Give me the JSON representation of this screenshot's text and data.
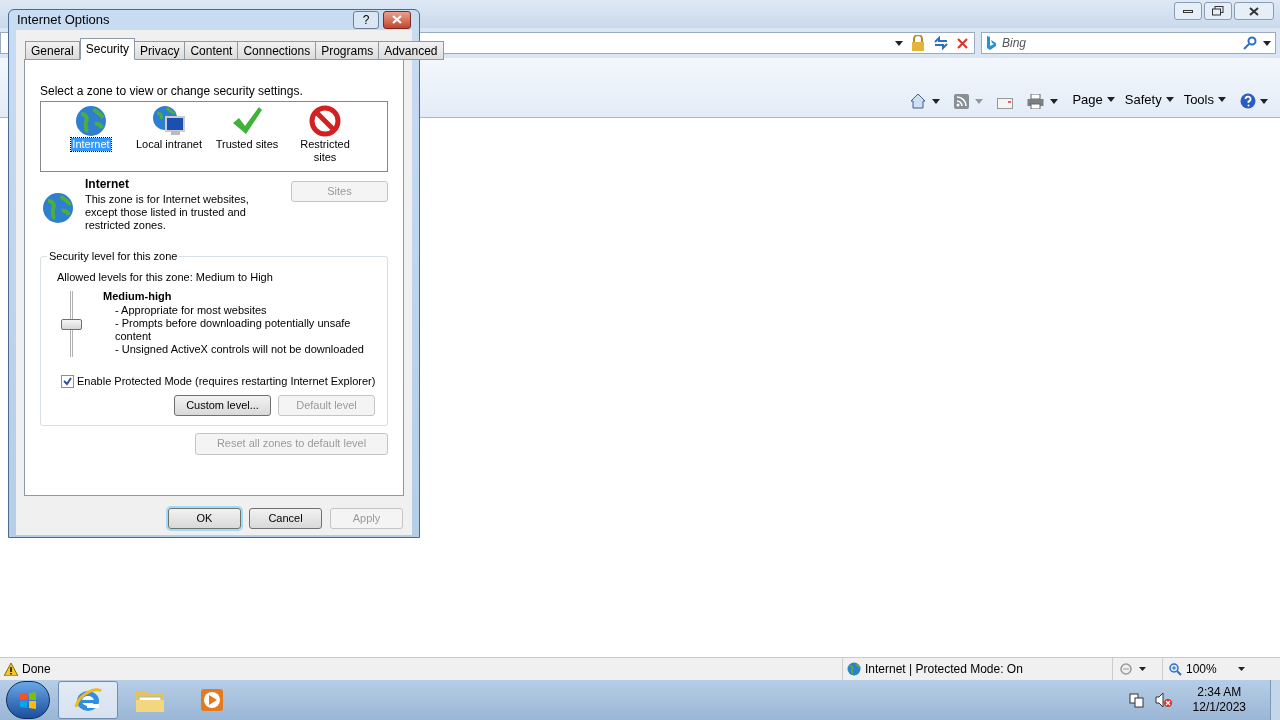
{
  "browser": {
    "search_placeholder": "Bing",
    "command_bar": [
      "Page",
      "Safety",
      "Tools"
    ],
    "status_bar": {
      "text": "Done",
      "zone": "Internet | Protected Mode: On",
      "zoom": "100%"
    }
  },
  "dialog": {
    "title": "Internet Options",
    "help": "?",
    "tabs": [
      {
        "label": "General",
        "selected": false
      },
      {
        "label": "Security",
        "selected": true
      },
      {
        "label": "Privacy",
        "selected": false
      },
      {
        "label": "Content",
        "selected": false
      },
      {
        "label": "Connections",
        "selected": false
      },
      {
        "label": "Programs",
        "selected": false
      },
      {
        "label": "Advanced",
        "selected": false
      }
    ],
    "instruction": "Select a zone to view or change security settings.",
    "zones": [
      {
        "label": "Internet",
        "kind": "globe",
        "selected": true
      },
      {
        "label": "Local intranet",
        "kind": "intranet",
        "selected": false
      },
      {
        "label": "Trusted sites",
        "kind": "trusted",
        "selected": false
      },
      {
        "label": "Restricted sites",
        "kind": "restricted",
        "selected": false
      }
    ],
    "zone_info": {
      "name": "Internet",
      "description": "This zone is for Internet websites, except those listed in trusted and restricted zones.",
      "sites_button": {
        "label": "Sites",
        "disabled": true
      }
    },
    "security_level": {
      "legend": "Security level for this zone",
      "allowed": "Allowed levels for this zone: Medium to High",
      "slider": {
        "level": 0.5
      },
      "level_name": "Medium-high",
      "details": [
        "- Appropriate for most websites",
        "- Prompts before downloading potentially unsafe content",
        "- Unsigned ActiveX controls will not be downloaded"
      ],
      "protected_mode": {
        "label": "Enable Protected Mode (requires restarting Internet Explorer)",
        "checked": true
      },
      "buttons": [
        {
          "label": "Custom level...",
          "disabled": false
        },
        {
          "label": "Default level",
          "disabled": true
        }
      ]
    },
    "reset_button": {
      "label": "Reset all zones to default level",
      "disabled": true
    },
    "buttons": [
      {
        "label": "OK",
        "disabled": false,
        "default": true
      },
      {
        "label": "Cancel",
        "disabled": false,
        "default": false
      },
      {
        "label": "Apply",
        "disabled": true,
        "default": false
      }
    ]
  },
  "taskbar": {
    "apps": [
      {
        "kind": "browser",
        "selected": true
      },
      {
        "kind": "folder",
        "selected": false
      },
      {
        "kind": "media",
        "selected": false
      }
    ],
    "clock": {
      "time": "2:34 AM",
      "date": "12/1/2023"
    }
  }
}
